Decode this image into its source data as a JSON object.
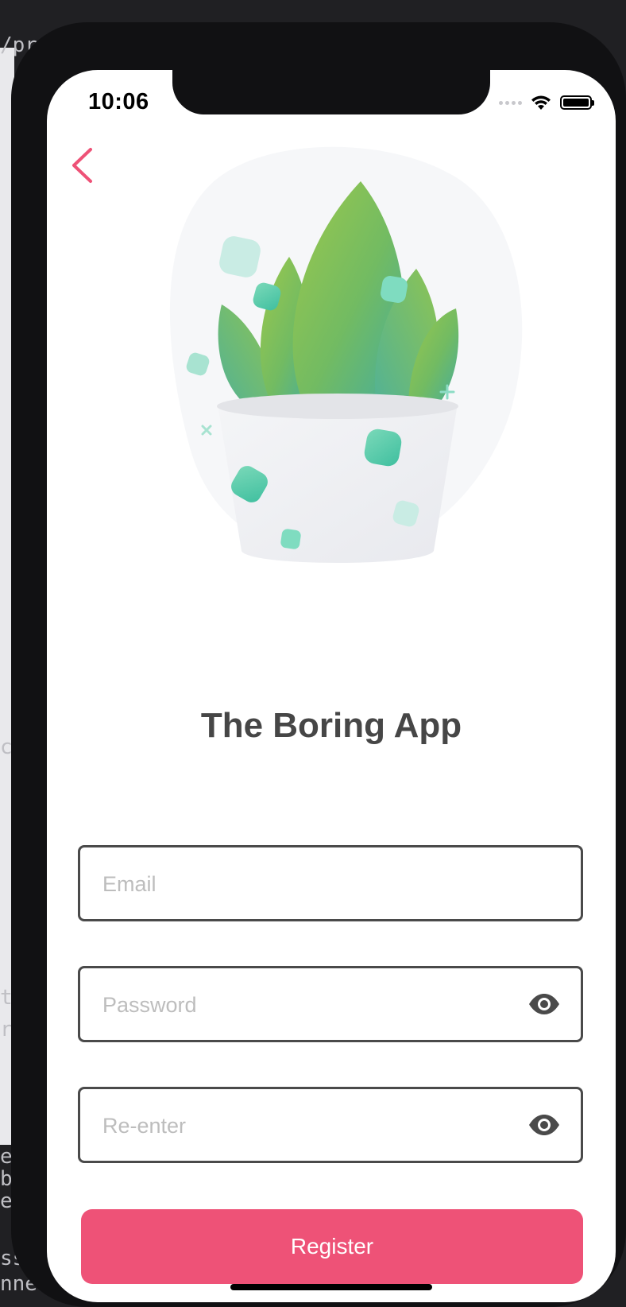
{
  "status_bar": {
    "time": "10:06",
    "icons": [
      "cellular-signal-icon",
      "wifi-icon",
      "battery-icon"
    ]
  },
  "nav": {
    "back_icon": "chevron-left-icon"
  },
  "illustration": {
    "subject": "potted-plant-illustration"
  },
  "app": {
    "title": "The Boring App"
  },
  "form": {
    "email_placeholder": "Email",
    "password_placeholder": "Password",
    "reenter_placeholder": "Re-enter",
    "visibility_icon": "eye-icon"
  },
  "actions": {
    "register_label": "Register"
  },
  "colors": {
    "accent": "#ee5277",
    "title_text": "#464646",
    "field_border": "#4a4a4a",
    "placeholder": "#bdbdbd",
    "leaf_green": "#8cc04f",
    "leaf_teal": "#4fb6a6"
  },
  "backdrop": {
    "editor_fragments": [
      "/pr",
      "co",
      "t",
      "re",
      "e",
      "b",
      "e",
      "ss",
      "nne"
    ]
  }
}
